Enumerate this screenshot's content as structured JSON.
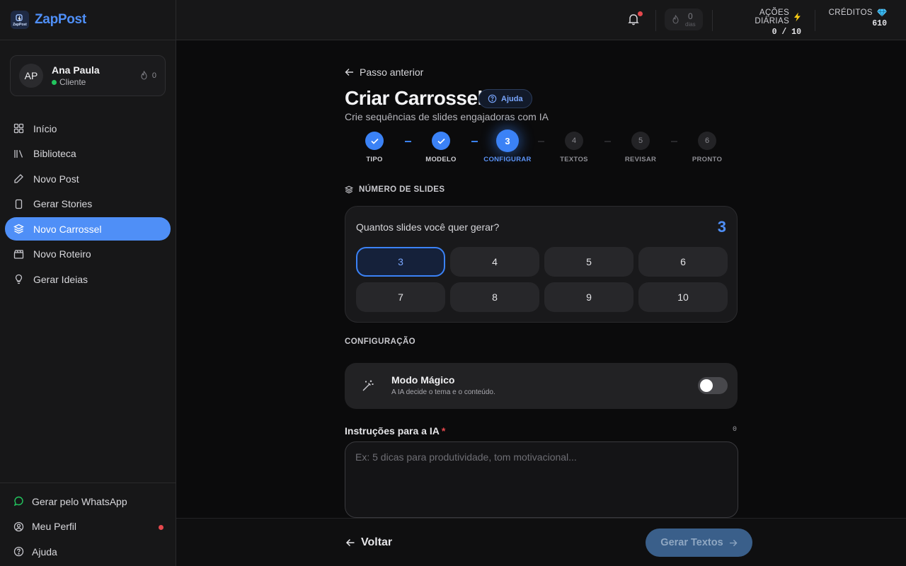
{
  "brand": {
    "name": "ZapPost",
    "logo_text": "ZapPost"
  },
  "user": {
    "initials": "AP",
    "name": "Ana Paula",
    "role": "Cliente",
    "streak": "0"
  },
  "nav": {
    "items": [
      {
        "label": "Início",
        "icon": "grid-icon"
      },
      {
        "label": "Biblioteca",
        "icon": "library-icon"
      },
      {
        "label": "Novo Post",
        "icon": "pencil-icon"
      },
      {
        "label": "Gerar Stories",
        "icon": "phone-icon"
      },
      {
        "label": "Novo Carrossel",
        "icon": "layers-icon",
        "active": true
      },
      {
        "label": "Novo Roteiro",
        "icon": "clapper-icon"
      },
      {
        "label": "Gerar Ideias",
        "icon": "lightbulb-icon"
      }
    ]
  },
  "sidebar_bottom": {
    "whatsapp": "Gerar pelo WhatsApp",
    "profile": "Meu Perfil",
    "help": "Ajuda"
  },
  "topbar": {
    "streak_value": "0",
    "streak_unit": "dias",
    "acoes_label": "AÇÕES DIÁRIAS",
    "acoes_value": "0 / 10",
    "creditos_label": "CRÉDITOS",
    "creditos_value": "610"
  },
  "page": {
    "back": "Passo anterior",
    "title": "Criar Carrossel",
    "help": "Ajuda",
    "subtitle": "Crie sequências de slides engajadoras com IA"
  },
  "steps": [
    {
      "num": "1",
      "label": "TIPO",
      "state": "done"
    },
    {
      "num": "2",
      "label": "MODELO",
      "state": "done"
    },
    {
      "num": "3",
      "label": "CONFIGURAR",
      "state": "current"
    },
    {
      "num": "4",
      "label": "TEXTOS",
      "state": "todo"
    },
    {
      "num": "5",
      "label": "REVISAR",
      "state": "todo"
    },
    {
      "num": "6",
      "label": "PRONTO",
      "state": "todo"
    }
  ],
  "slides": {
    "section_label": "NÚMERO DE SLIDES",
    "question": "Quantos slides você quer gerar?",
    "selected": "3",
    "options": [
      "3",
      "4",
      "5",
      "6",
      "7",
      "8",
      "9",
      "10"
    ]
  },
  "config": {
    "section_label": "CONFIGURAÇÃO",
    "magic_title": "Modo Mágico",
    "magic_sub": "A IA decide o tema e o conteúdo.",
    "magic_enabled": false
  },
  "instructions": {
    "label": "Instruções para a IA",
    "required_mark": "*",
    "count": "0",
    "placeholder": "Ex: 5 dicas para produtividade, tom motivacional...",
    "value": ""
  },
  "footer": {
    "back": "Voltar",
    "next": "Gerar Textos"
  },
  "colors": {
    "accent": "#4f8ff7",
    "active_nav": "#4f8ff7",
    "danger": "#e5484d",
    "success": "#22c55e"
  }
}
